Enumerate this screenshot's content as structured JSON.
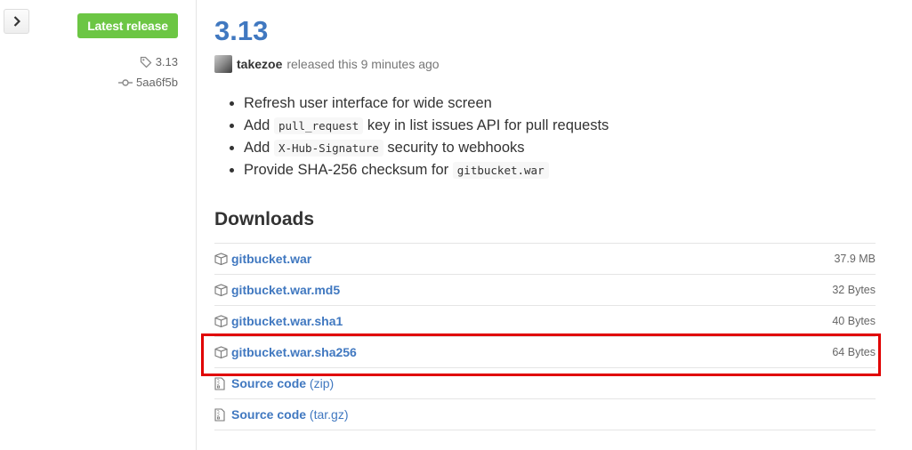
{
  "sidebar": {
    "badge": "Latest release",
    "tag": "3.13",
    "commit": "5aa6f5b",
    "tag_icon": "tag-icon",
    "commit_icon": "git-commit-icon",
    "expand_icon": "chevron-right-icon",
    "badge_color": "#6cc644"
  },
  "release": {
    "title": "3.13",
    "author": "takezoe",
    "released_text": "released this 9 minutes ago",
    "notes": [
      {
        "before": "Refresh user interface for wide screen",
        "code": "",
        "after": ""
      },
      {
        "before": "Add ",
        "code": "pull_request",
        "after": " key in list issues API for pull requests"
      },
      {
        "before": "Add ",
        "code": "X-Hub-Signature",
        "after": " security to webhooks"
      },
      {
        "before": "Provide SHA-256 checksum for ",
        "code": "gitbucket.war",
        "after": ""
      }
    ]
  },
  "downloads": {
    "heading": "Downloads",
    "items": [
      {
        "name": "gitbucket.war",
        "format": "",
        "size": "37.9 MB",
        "icon": "package-icon"
      },
      {
        "name": "gitbucket.war.md5",
        "format": "",
        "size": "32 Bytes",
        "icon": "package-icon"
      },
      {
        "name": "gitbucket.war.sha1",
        "format": "",
        "size": "40 Bytes",
        "icon": "package-icon"
      },
      {
        "name": "gitbucket.war.sha256",
        "format": "",
        "size": "64 Bytes",
        "icon": "package-icon"
      },
      {
        "name": "Source code",
        "format": "(zip)",
        "size": "",
        "icon": "file-zip-icon"
      },
      {
        "name": "Source code",
        "format": "(tar.gz)",
        "size": "",
        "icon": "file-zip-icon"
      }
    ]
  },
  "colors": {
    "link": "#4078c0",
    "highlight": "#e00000"
  }
}
